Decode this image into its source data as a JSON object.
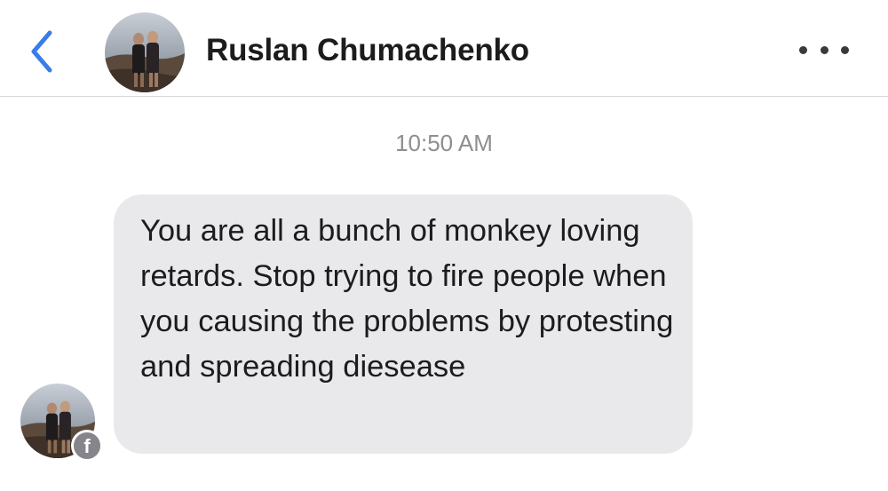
{
  "header": {
    "back_icon": "chevron-left-icon",
    "contact_name": "Ruslan Chumachenko",
    "more_icon": "ellipsis-icon",
    "accent_color": "#3b7de8"
  },
  "conversation": {
    "timestamp": "10:50 AM",
    "messages": [
      {
        "sender": "Ruslan Chumachenko",
        "text": "You are all a bunch of monkey loving retards. Stop trying to fire people when you causing the problems by protesting and spreading diesease",
        "bubble_color": "#e9e9eb",
        "platform_badge": "facebook-icon",
        "platform_badge_glyph": "f"
      }
    ]
  }
}
